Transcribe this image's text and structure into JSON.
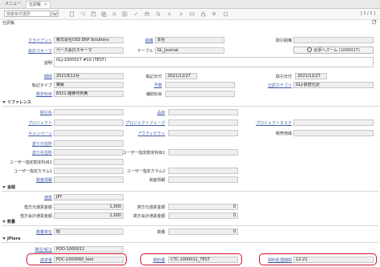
{
  "tabs": [
    {
      "label": "メニュー"
    },
    {
      "label": "仕訳帳",
      "close": "✕"
    }
  ],
  "toolbar": {
    "search_placeholder": "検索条件選択",
    "pager": "1 / 1",
    "icons": [
      "new-icon",
      "undo-icon",
      "save-icon",
      "copy-icon",
      "delete-icon",
      "grid-icon",
      "attach-icon",
      "print-icon",
      "find-icon",
      "prev-icon",
      "next-icon",
      "chat-icon",
      "lock-icon",
      "zoom-icon",
      "help-icon"
    ]
  },
  "subtitle": "仕訳帳",
  "header": {
    "client_label": "クライアント",
    "client_value": "株式会社OSS ERP Solutions",
    "org_label": "組織",
    "org_value": "本社",
    "gl_category_label": "取引組織",
    "gl_category_value": "",
    "schema_label": "会計スキーマ",
    "schema_value": "ベース会計スキーマ",
    "table_label": "テーブル",
    "table_value": "GL_Journal",
    "zoom_button": "伝票へズーム (1000027)",
    "description_label": "説明",
    "description_value": "GLJ-1000027 #10 (TEST)",
    "period_label": "期間",
    "period_value": "2021年12月",
    "trx_date_label": "転記日付",
    "trx_date_value": "2021/12/27",
    "acct_date_label": "取引日付",
    "acct_date_value": "2021/12/27",
    "post_type_label": "転記タイプ",
    "post_type_value": "実績",
    "budget_label": "予算",
    "budget_value": "",
    "journal_cat_label": "仕訳カテゴリ",
    "journal_cat_value": "GLJ-振替仕訳",
    "account_label": "勘定科目",
    "account_value": "8321-雑費可判費",
    "sub_account_label": "補助科目",
    "sub_account_value": ""
  },
  "reference": {
    "title": "リファレンス",
    "bpartner_label": "取引先",
    "product_label": "品目",
    "project_label": "プロジェクト",
    "project_phase_label": "プロジェクトフェーズ",
    "project_task_label": "プロジェクトタスク",
    "campaign_label": "キャンペーン",
    "activity_label": "アクティビティ",
    "sales_region_label": "販売地域",
    "loc_from_label": "送り元住所",
    "loc_to_label": "送り先住所",
    "user1_label": "ユーザー指定勘定科目1",
    "user2_label": "ユーザー指定勘定科目2",
    "user_col1_label": "ユーザー指定カラム1",
    "user_col2_label": "ユーザー指定カラム2",
    "tax_label": "税金情報",
    "asset_label": "資産情報"
  },
  "amount": {
    "title": "金額",
    "currency_label": "通貨",
    "currency_value": "JPY",
    "src_dr_label": "借方元通貨金額",
    "src_dr_value": "1,000",
    "src_cr_label": "貸方元通貨金額",
    "src_cr_value": "0",
    "acct_dr_label": "借方会計通貨金額",
    "acct_dr_value": "1,000",
    "acct_cr_label": "貸方会計通貨金額",
    "acct_cr_value": "0"
  },
  "quantity": {
    "title": "数量",
    "uom_label": "数量単位",
    "uom_value": "個",
    "qty_label": "数量",
    "qty_value": "0"
  },
  "jpiere": {
    "title": "JPiere",
    "order_label": "発注/受注",
    "order_value": "POO-1000012",
    "invoice_label": "請求書",
    "invoice_value": "PDC-1000060_test",
    "contract_label": "契約書",
    "contract_value": "CTC-1000011_TEST",
    "contract_period_label": "契約処理期間",
    "contract_period_value": "12-21"
  },
  "highlight_color": "#d4122a"
}
